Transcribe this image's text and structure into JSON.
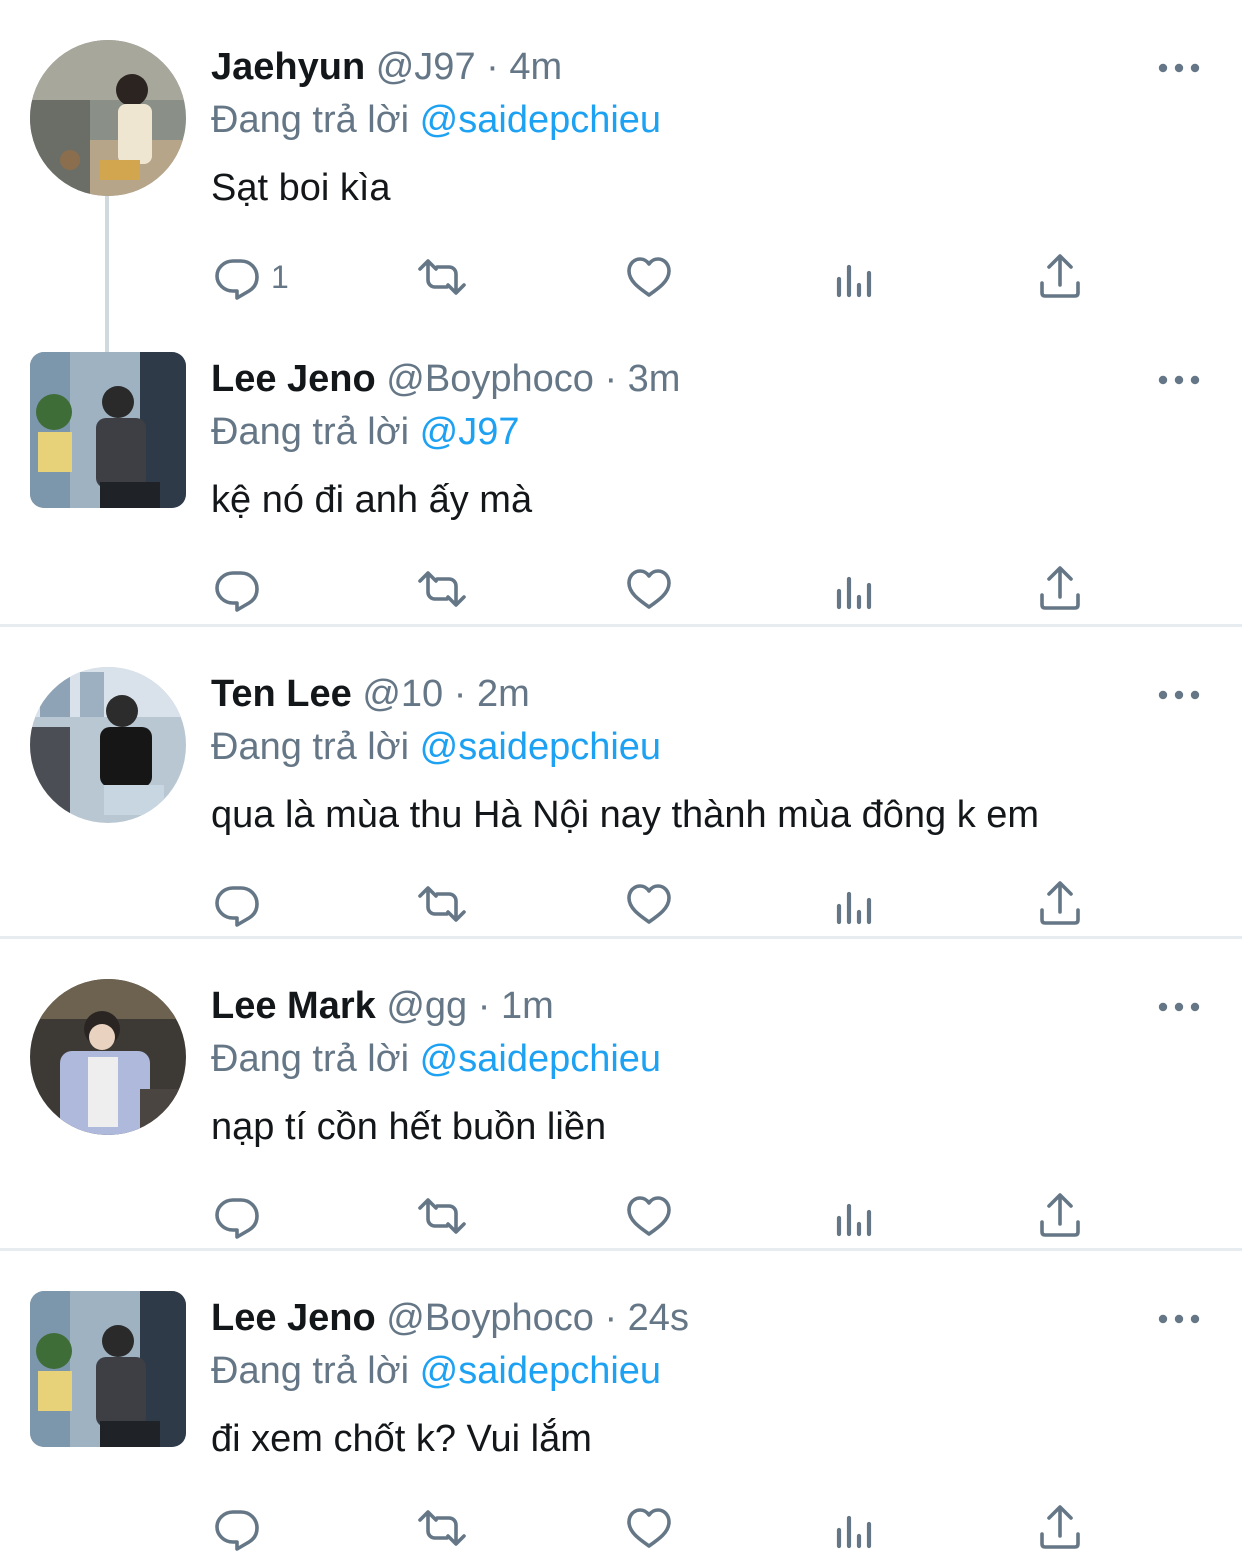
{
  "colors": {
    "mention": "#1da1f2",
    "secondary_text": "#657786",
    "primary_text": "#14171a",
    "divider": "#e6ecf0"
  },
  "icons": {
    "more": "more-horizontal-icon",
    "reply": "reply-bubble-icon",
    "retweet": "retweet-icon",
    "like": "heart-icon",
    "analytics": "analytics-bars-icon",
    "share": "share-upload-icon"
  },
  "reply_prefix": "Đang trả lời",
  "tweets": [
    {
      "name": "Jaehyun",
      "handle": "@J97",
      "separator": "·",
      "time": "4m",
      "reply_to": "@saidepchieu",
      "text": "Sạt boi kìa",
      "reply_count": "1"
    },
    {
      "name": "Lee Jeno",
      "handle": "@Boyphoco",
      "separator": "·",
      "time": "3m",
      "reply_to": "@J97",
      "text": "kệ nó đi anh ấy mà",
      "reply_count": ""
    },
    {
      "name": "Ten Lee",
      "handle": "@10",
      "separator": "·",
      "time": "2m",
      "reply_to": "@saidepchieu",
      "text": "qua là mùa thu Hà Nội nay thành mùa đông k em",
      "reply_count": ""
    },
    {
      "name": "Lee Mark",
      "handle": "@gg",
      "separator": "·",
      "time": "1m",
      "reply_to": "@saidepchieu",
      "text": "nạp tí cồn hết buồn liền",
      "reply_count": ""
    },
    {
      "name": "Lee Jeno",
      "handle": "@Boyphoco",
      "separator": "·",
      "time": "24s",
      "reply_to": "@saidepchieu",
      "text": "đi xem chốt k? Vui lắm",
      "reply_count": ""
    }
  ]
}
